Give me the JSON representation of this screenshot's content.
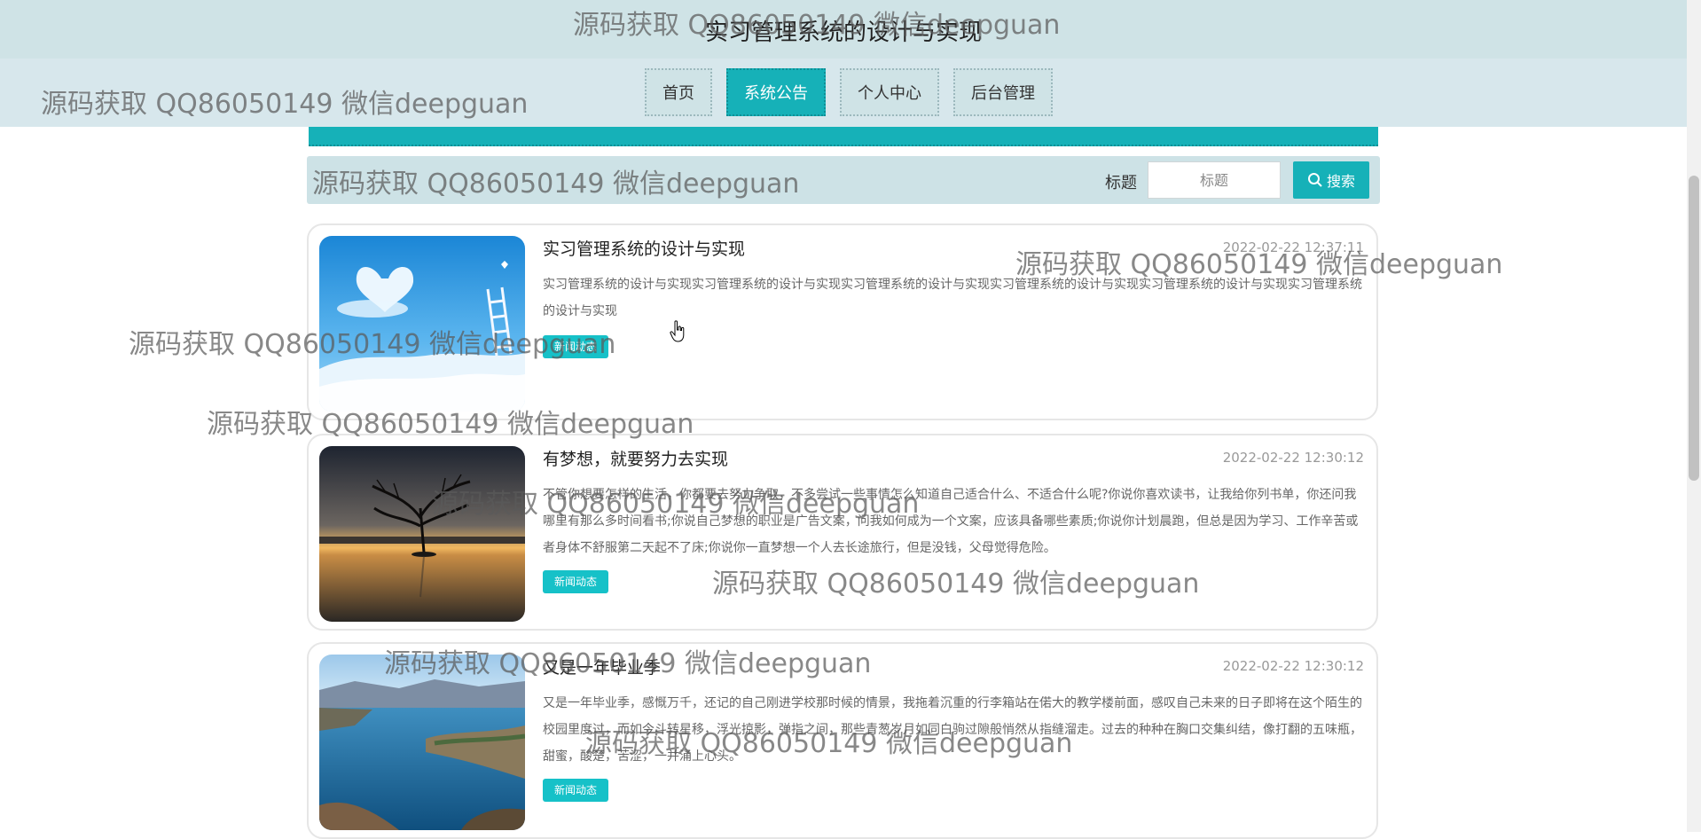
{
  "header": {
    "title": "实习管理系统的设计与实现"
  },
  "nav": {
    "items": [
      {
        "label": "首页",
        "active": false
      },
      {
        "label": "系统公告",
        "active": true
      },
      {
        "label": "个人中心",
        "active": false
      },
      {
        "label": "后台管理",
        "active": false
      }
    ]
  },
  "search": {
    "label": "标题",
    "placeholder": "标题",
    "button_label": "搜索",
    "button_icon": "search-icon"
  },
  "articles": [
    {
      "title": "实习管理系统的设计与实现",
      "date": "2022-02-22 12:37:11",
      "body": "实习管理系统的设计与实现实习管理系统的设计与实现实习管理系统的设计与实现实习管理系统的设计与实现实习管理系统的设计与实现实习管理系统的设计与实现",
      "tag": "新闻动态",
      "image": "sky-heart-ladder-image"
    },
    {
      "title": "有梦想，就要努力去实现",
      "date": "2022-02-22 12:30:12",
      "body": "不管你想要怎样的生活，你都要去努力争取，不多尝试一些事情怎么知道自己适合什么、不适合什么呢?你说你喜欢读书，让我给你列书单，你还问我哪里有那么多时间看书;你说自己梦想的职业是广告文案，问我如何成为一个文案，应该具备哪些素质;你说你计划晨跑，但总是因为学习、工作辛苦或者身体不舒服第二天起不了床;你说你一直梦想一个人去长途旅行，但是没钱，父母觉得危险。",
      "tag": "新闻动态",
      "image": "lake-tree-sunset-image"
    },
    {
      "title": "又是一年毕业季",
      "date": "2022-02-22 12:30:12",
      "body": "又是一年毕业季，感慨万千，还记的自己刚进学校那时候的情景，我拖着沉重的行李箱站在偌大的教学楼前面，感叹自己未来的日子即将在这个陌生的校园里度过，而如今斗转星移，浮光掠影，弹指之间，那些青葱岁月如同白驹过隙般悄然从指缝溜走。过去的种种在胸口交集纠结，像打翻的五味瓶，甜蜜，酸楚，苦涩，一并涌上心头。",
      "tag": "新闻动态",
      "image": "lake-peninsula-image"
    }
  ],
  "watermark": "源码获取 QQ86050149 微信deepguan",
  "colors": {
    "accent": "#16b1b8",
    "header_bg": "#cfe3e6",
    "tag_bg": "#16c1c8"
  }
}
